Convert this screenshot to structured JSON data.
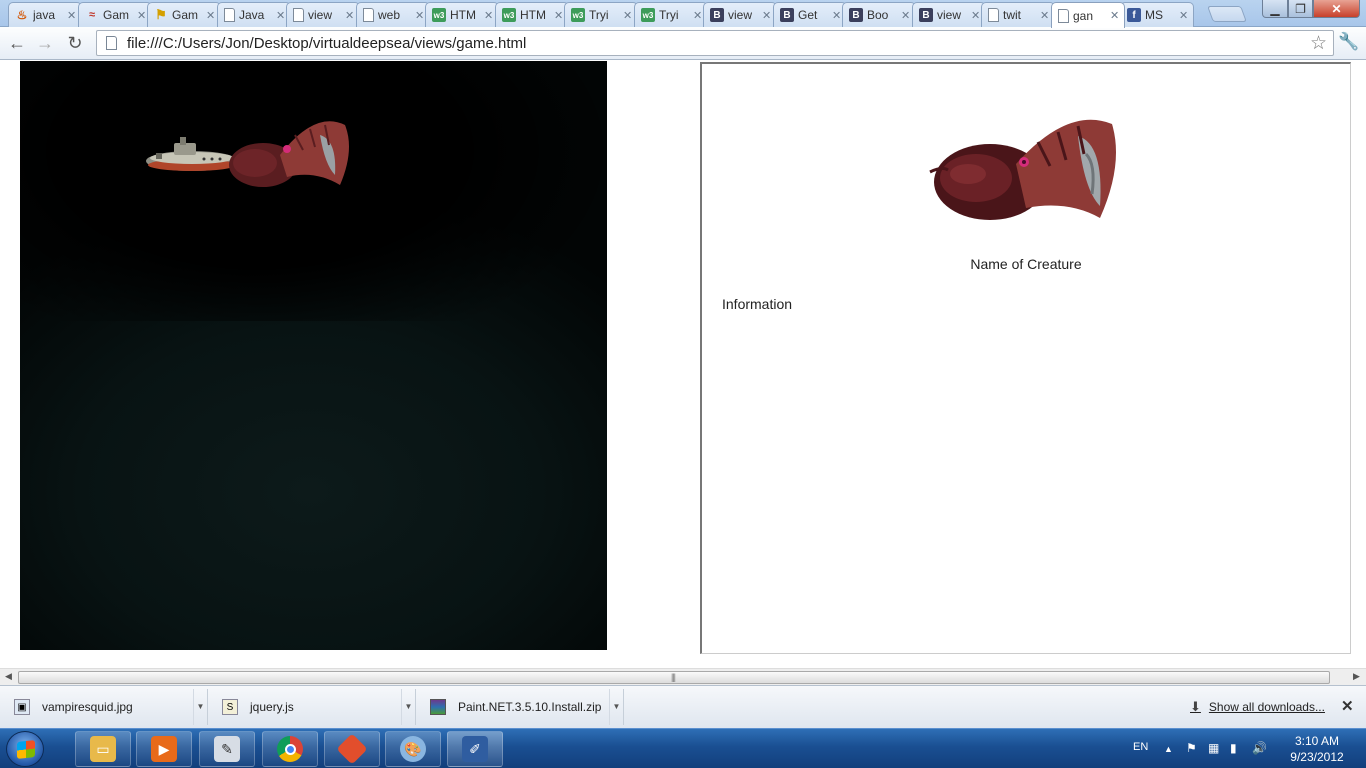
{
  "browser": {
    "tabs": [
      {
        "label": "java",
        "favicon": "java-icon",
        "active": false
      },
      {
        "label": "Gam",
        "favicon": "gamedev-icon",
        "active": false
      },
      {
        "label": "Gam",
        "favicon": "flag-icon",
        "active": false
      },
      {
        "label": "Java",
        "favicon": "page-icon",
        "active": false
      },
      {
        "label": "view",
        "favicon": "page-icon",
        "active": false
      },
      {
        "label": "web",
        "favicon": "page-icon",
        "active": false
      },
      {
        "label": "HTM",
        "favicon": "w3schools-icon",
        "active": false
      },
      {
        "label": "HTM",
        "favicon": "w3schools-icon",
        "active": false
      },
      {
        "label": "Tryi",
        "favicon": "w3schools-icon",
        "active": false
      },
      {
        "label": "Tryi",
        "favicon": "w3schools-icon",
        "active": false
      },
      {
        "label": "view",
        "favicon": "bootstrap-icon",
        "active": false
      },
      {
        "label": "Get",
        "favicon": "bootstrap-icon",
        "active": false
      },
      {
        "label": "Boo",
        "favicon": "bootstrap-icon",
        "active": false
      },
      {
        "label": "view",
        "favicon": "bootstrap-icon",
        "active": false
      },
      {
        "label": "twit",
        "favicon": "page-icon",
        "active": false
      },
      {
        "label": "gan",
        "favicon": "page-icon",
        "active": true
      },
      {
        "label": "MS",
        "favicon": "facebook-icon",
        "active": false
      }
    ],
    "url": "file:///C:/Users/Jon/Desktop/virtualdeepsea/views/game.html"
  },
  "page": {
    "creature_name": "Name of Creature",
    "information": "Information"
  },
  "downloads": {
    "items": [
      {
        "name": "vampiresquid.jpg",
        "icon": "image-file-icon"
      },
      {
        "name": "jquery.js",
        "icon": "script-file-icon"
      },
      {
        "name": "Paint.NET.3.5.10.Install.zip",
        "icon": "archive-file-icon"
      }
    ],
    "show_all": "Show all downloads..."
  },
  "taskbar": {
    "apps": [
      {
        "name": "file-explorer-icon",
        "color": "#e8b94a"
      },
      {
        "name": "media-player-icon",
        "color": "#e86a1a"
      },
      {
        "name": "notepad-icon",
        "color": "#d7dde5"
      },
      {
        "name": "chrome-icon",
        "color": "#3b8e3b"
      },
      {
        "name": "git-icon",
        "color": "#e24e2c"
      },
      {
        "name": "paint-icon",
        "color": "#8ab6e0"
      },
      {
        "name": "paint-net-icon",
        "color": "#2f5da0"
      }
    ],
    "language": "EN",
    "time": "3:10 AM",
    "date": "9/23/2012"
  }
}
